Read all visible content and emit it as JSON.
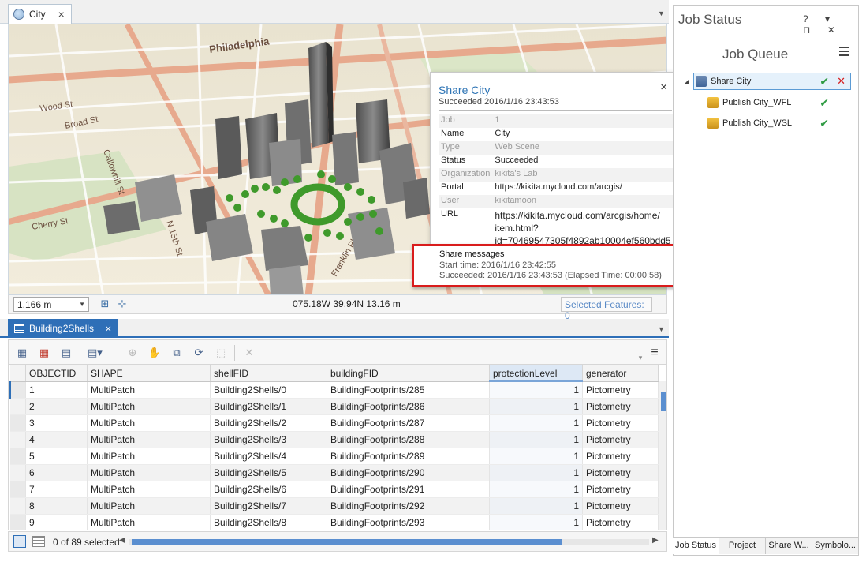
{
  "map_view": {
    "tab_label": "City",
    "street_labels": [
      "Philadelphia",
      "Broad St",
      "Wood St",
      "Callowhill St",
      "N 15th St",
      "Cherry St",
      "Franklin Pkwy"
    ]
  },
  "map_status": {
    "scale": "1,166 m",
    "coordinates": "075.18W 39.94N  13.16 m",
    "selected_features": "Selected Features: 0"
  },
  "popup": {
    "title": "Share City",
    "subtitle": "Succeeded 2016/1/16 23:43:53",
    "close": "×",
    "rows": [
      {
        "key": "Job",
        "value": "1"
      },
      {
        "key": "Name",
        "value": "City"
      },
      {
        "key": "Type",
        "value": "Web Scene"
      },
      {
        "key": "Status",
        "value": "Succeeded"
      },
      {
        "key": "Organization",
        "value": "kikita's Lab"
      },
      {
        "key": "Portal",
        "value": "https://kikita.mycloud.com/arcgis/"
      },
      {
        "key": "User",
        "value": "kikitamoon"
      },
      {
        "key": "URL",
        "value": "https://kikita.mycloud.com/arcgis/home/item.html?id=70469547305f4892ab10004ef560bdd5"
      }
    ],
    "url_lines": [
      "https://kikita.mycloud.com/arcgis/home/",
      "item.html?",
      "id=70469547305f4892ab10004ef560bdd5"
    ]
  },
  "share_messages": {
    "title": "Share messages",
    "start": "Start time: 2016/1/16 23:42:55",
    "end": "Succeeded: 2016/1/16 23:43:53 (Elapsed Time:  00:00:58)"
  },
  "attribute_table": {
    "tab_label": "Building2Shells",
    "columns": [
      "OBJECTID",
      "SHAPE",
      "shellFID",
      "buildingFID",
      "protectionLevel",
      "generator"
    ],
    "rows": [
      [
        "1",
        "MultiPatch",
        "Building2Shells/0",
        "BuildingFootprints/285",
        "1",
        "Pictometry"
      ],
      [
        "2",
        "MultiPatch",
        "Building2Shells/1",
        "BuildingFootprints/286",
        "1",
        "Pictometry"
      ],
      [
        "3",
        "MultiPatch",
        "Building2Shells/2",
        "BuildingFootprints/287",
        "1",
        "Pictometry"
      ],
      [
        "4",
        "MultiPatch",
        "Building2Shells/3",
        "BuildingFootprints/288",
        "1",
        "Pictometry"
      ],
      [
        "5",
        "MultiPatch",
        "Building2Shells/4",
        "BuildingFootprints/289",
        "1",
        "Pictometry"
      ],
      [
        "6",
        "MultiPatch",
        "Building2Shells/5",
        "BuildingFootprints/290",
        "1",
        "Pictometry"
      ],
      [
        "7",
        "MultiPatch",
        "Building2Shells/6",
        "BuildingFootprints/291",
        "1",
        "Pictometry"
      ],
      [
        "8",
        "MultiPatch",
        "Building2Shells/7",
        "BuildingFootprints/292",
        "1",
        "Pictometry"
      ],
      [
        "9",
        "MultiPatch",
        "Building2Shells/8",
        "BuildingFootprints/293",
        "1",
        "Pictometry"
      ]
    ],
    "selection_status": "0 of 89 selected"
  },
  "job_status": {
    "title": "Job Status",
    "controls": "? ▾ ⊓ ✕",
    "queue_title": "Job Queue",
    "jobs": [
      {
        "label": "Share City",
        "status": "succeeded",
        "icon": "share-web-scene-icon"
      },
      {
        "label": "Publish City_WFL",
        "status": "succeeded",
        "icon": "publish-layer-icon"
      },
      {
        "label": "Publish City_WSL",
        "status": "succeeded",
        "icon": "publish-layer-icon"
      }
    ],
    "check": "✔",
    "cancel": "✕"
  },
  "pane_tabs": [
    "Job Status",
    "Project",
    "Share W...",
    "Symbolo..."
  ],
  "colors": {
    "accent": "#2e6fb7",
    "highlight_border": "#d91c1c",
    "success": "#2f9b43",
    "link": "#2e74b5"
  }
}
